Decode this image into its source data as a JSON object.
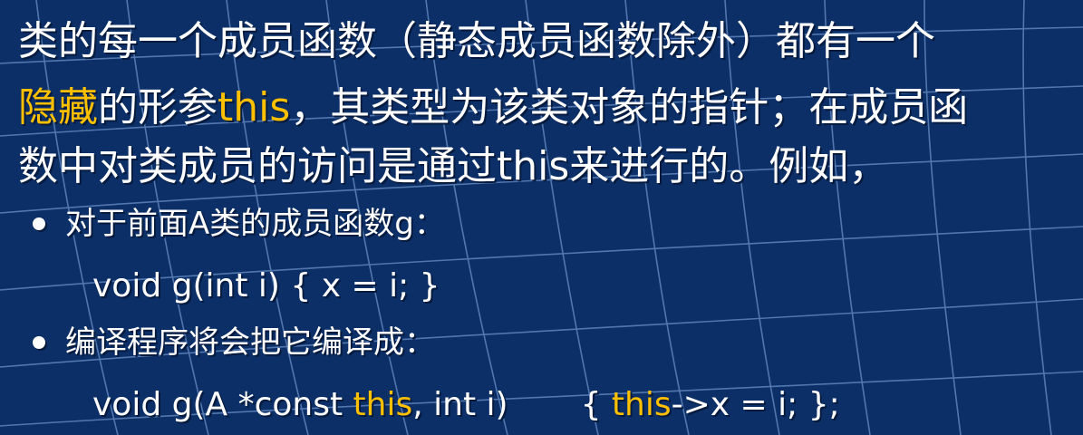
{
  "paragraph": {
    "line1": "类的每一个成员函数（静态成员函数除外）都有一个",
    "line2_hidden": "隐藏",
    "line2_mid": "的形参",
    "line2_this": "this",
    "line2_rest": "，其类型为该类对象的指针；在成员函",
    "line3": "数中对类成员的访问是通过this来进行的。例如，"
  },
  "bullets": [
    {
      "text": "对于前面A类的成员函数g："
    },
    {
      "text": "编译程序将会把它编译成："
    }
  ],
  "code": {
    "original": "void g(int i) { x = i; }",
    "compiled_part1": "void g(A *const ",
    "compiled_this1": "this",
    "compiled_part2": ", int i)",
    "compiled_part3": "{ ",
    "compiled_this2": "this",
    "compiled_part4": "->x = i; };"
  },
  "colors": {
    "background": "#0b2f66",
    "grid": "#6a8fc8",
    "text": "#ffffff",
    "highlight": "#ffc000"
  }
}
